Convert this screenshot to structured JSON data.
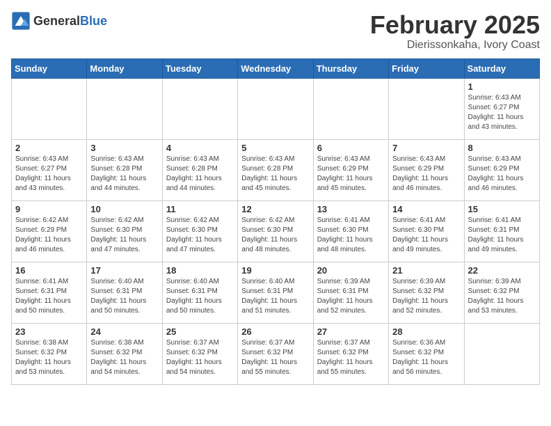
{
  "logo": {
    "general": "General",
    "blue": "Blue"
  },
  "header": {
    "month": "February 2025",
    "location": "Dierissonkaha, Ivory Coast"
  },
  "weekdays": [
    "Sunday",
    "Monday",
    "Tuesday",
    "Wednesday",
    "Thursday",
    "Friday",
    "Saturday"
  ],
  "weeks": [
    [
      {
        "day": "",
        "info": ""
      },
      {
        "day": "",
        "info": ""
      },
      {
        "day": "",
        "info": ""
      },
      {
        "day": "",
        "info": ""
      },
      {
        "day": "",
        "info": ""
      },
      {
        "day": "",
        "info": ""
      },
      {
        "day": "1",
        "info": "Sunrise: 6:43 AM\nSunset: 6:27 PM\nDaylight: 11 hours\nand 43 minutes."
      }
    ],
    [
      {
        "day": "2",
        "info": "Sunrise: 6:43 AM\nSunset: 6:27 PM\nDaylight: 11 hours\nand 43 minutes."
      },
      {
        "day": "3",
        "info": "Sunrise: 6:43 AM\nSunset: 6:28 PM\nDaylight: 11 hours\nand 44 minutes."
      },
      {
        "day": "4",
        "info": "Sunrise: 6:43 AM\nSunset: 6:28 PM\nDaylight: 11 hours\nand 44 minutes."
      },
      {
        "day": "5",
        "info": "Sunrise: 6:43 AM\nSunset: 6:28 PM\nDaylight: 11 hours\nand 45 minutes."
      },
      {
        "day": "6",
        "info": "Sunrise: 6:43 AM\nSunset: 6:29 PM\nDaylight: 11 hours\nand 45 minutes."
      },
      {
        "day": "7",
        "info": "Sunrise: 6:43 AM\nSunset: 6:29 PM\nDaylight: 11 hours\nand 46 minutes."
      },
      {
        "day": "8",
        "info": "Sunrise: 6:43 AM\nSunset: 6:29 PM\nDaylight: 11 hours\nand 46 minutes."
      }
    ],
    [
      {
        "day": "9",
        "info": "Sunrise: 6:42 AM\nSunset: 6:29 PM\nDaylight: 11 hours\nand 46 minutes."
      },
      {
        "day": "10",
        "info": "Sunrise: 6:42 AM\nSunset: 6:30 PM\nDaylight: 11 hours\nand 47 minutes."
      },
      {
        "day": "11",
        "info": "Sunrise: 6:42 AM\nSunset: 6:30 PM\nDaylight: 11 hours\nand 47 minutes."
      },
      {
        "day": "12",
        "info": "Sunrise: 6:42 AM\nSunset: 6:30 PM\nDaylight: 11 hours\nand 48 minutes."
      },
      {
        "day": "13",
        "info": "Sunrise: 6:41 AM\nSunset: 6:30 PM\nDaylight: 11 hours\nand 48 minutes."
      },
      {
        "day": "14",
        "info": "Sunrise: 6:41 AM\nSunset: 6:30 PM\nDaylight: 11 hours\nand 49 minutes."
      },
      {
        "day": "15",
        "info": "Sunrise: 6:41 AM\nSunset: 6:31 PM\nDaylight: 11 hours\nand 49 minutes."
      }
    ],
    [
      {
        "day": "16",
        "info": "Sunrise: 6:41 AM\nSunset: 6:31 PM\nDaylight: 11 hours\nand 50 minutes."
      },
      {
        "day": "17",
        "info": "Sunrise: 6:40 AM\nSunset: 6:31 PM\nDaylight: 11 hours\nand 50 minutes."
      },
      {
        "day": "18",
        "info": "Sunrise: 6:40 AM\nSunset: 6:31 PM\nDaylight: 11 hours\nand 50 minutes."
      },
      {
        "day": "19",
        "info": "Sunrise: 6:40 AM\nSunset: 6:31 PM\nDaylight: 11 hours\nand 51 minutes."
      },
      {
        "day": "20",
        "info": "Sunrise: 6:39 AM\nSunset: 6:31 PM\nDaylight: 11 hours\nand 52 minutes."
      },
      {
        "day": "21",
        "info": "Sunrise: 6:39 AM\nSunset: 6:32 PM\nDaylight: 11 hours\nand 52 minutes."
      },
      {
        "day": "22",
        "info": "Sunrise: 6:39 AM\nSunset: 6:32 PM\nDaylight: 11 hours\nand 53 minutes."
      }
    ],
    [
      {
        "day": "23",
        "info": "Sunrise: 6:38 AM\nSunset: 6:32 PM\nDaylight: 11 hours\nand 53 minutes."
      },
      {
        "day": "24",
        "info": "Sunrise: 6:38 AM\nSunset: 6:32 PM\nDaylight: 11 hours\nand 54 minutes."
      },
      {
        "day": "25",
        "info": "Sunrise: 6:37 AM\nSunset: 6:32 PM\nDaylight: 11 hours\nand 54 minutes."
      },
      {
        "day": "26",
        "info": "Sunrise: 6:37 AM\nSunset: 6:32 PM\nDaylight: 11 hours\nand 55 minutes."
      },
      {
        "day": "27",
        "info": "Sunrise: 6:37 AM\nSunset: 6:32 PM\nDaylight: 11 hours\nand 55 minutes."
      },
      {
        "day": "28",
        "info": "Sunrise: 6:36 AM\nSunset: 6:32 PM\nDaylight: 11 hours\nand 56 minutes."
      },
      {
        "day": "",
        "info": ""
      }
    ]
  ]
}
